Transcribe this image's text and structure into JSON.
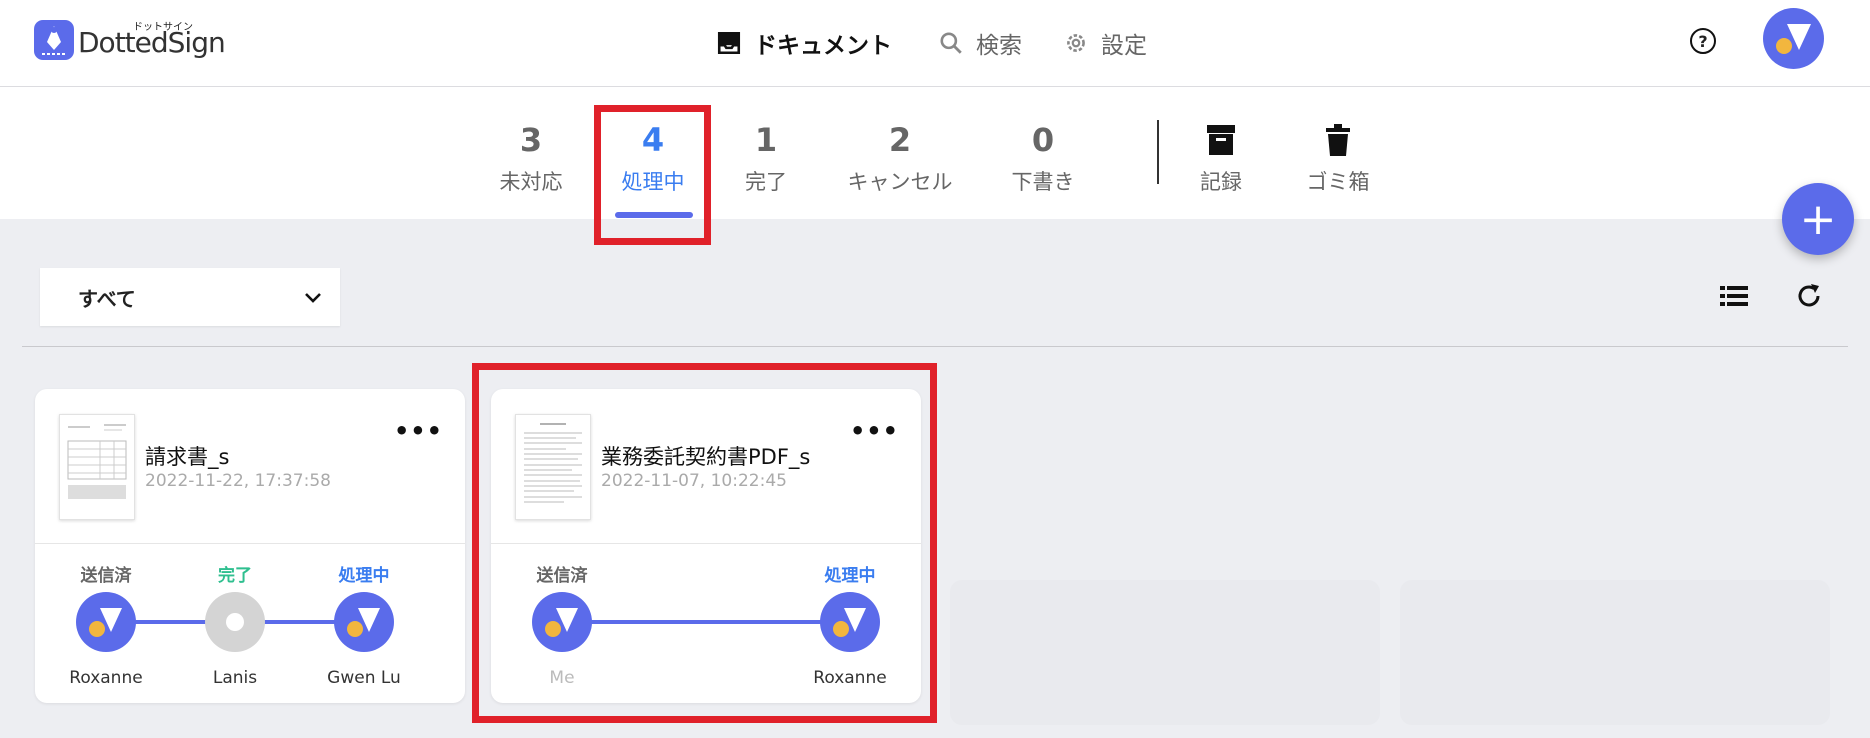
{
  "app": {
    "name": "DottedSign",
    "kana": "ドットサイン"
  },
  "nav": {
    "documents": "ドキュメント",
    "search": "検索",
    "settings": "設定"
  },
  "help_symbol": "?",
  "tabs": [
    {
      "count": "3",
      "label": "未対応"
    },
    {
      "count": "4",
      "label": "処理中"
    },
    {
      "count": "1",
      "label": "完了"
    },
    {
      "count": "2",
      "label": "キャンセル"
    },
    {
      "count": "0",
      "label": "下書き"
    }
  ],
  "archive": {
    "records": "記録",
    "trash": "ゴミ箱"
  },
  "fab_symbol": "+",
  "filter": {
    "selected": "すべて"
  },
  "cards": [
    {
      "title": "請求書_s",
      "date": "2022-11-22, 17:37:58",
      "more": "•••",
      "participants": [
        {
          "status": "送信済",
          "name": "Roxanne"
        },
        {
          "status": "完了",
          "name": "Lanis"
        },
        {
          "status": "処理中",
          "name": "Gwen Lu"
        }
      ]
    },
    {
      "title": "業務委託契約書PDF_s",
      "date": "2022-11-07, 10:22:45",
      "more": "•••",
      "participants": [
        {
          "status": "送信済",
          "name": "Me"
        },
        {
          "status": "処理中",
          "name": "Roxanne"
        }
      ]
    }
  ],
  "colors": {
    "accent": "#5b6bea",
    "active_text": "#3a7df0",
    "done_text": "#2fbf8f",
    "highlight": "#e0212a",
    "avatar_dot": "#f2b63e"
  },
  "icons": [
    "inbox-icon",
    "search-icon",
    "gear-icon",
    "help-icon",
    "archive-icon",
    "trash-icon",
    "chevron-down-icon",
    "list-view-icon",
    "refresh-icon",
    "plus-icon",
    "more-icon"
  ]
}
